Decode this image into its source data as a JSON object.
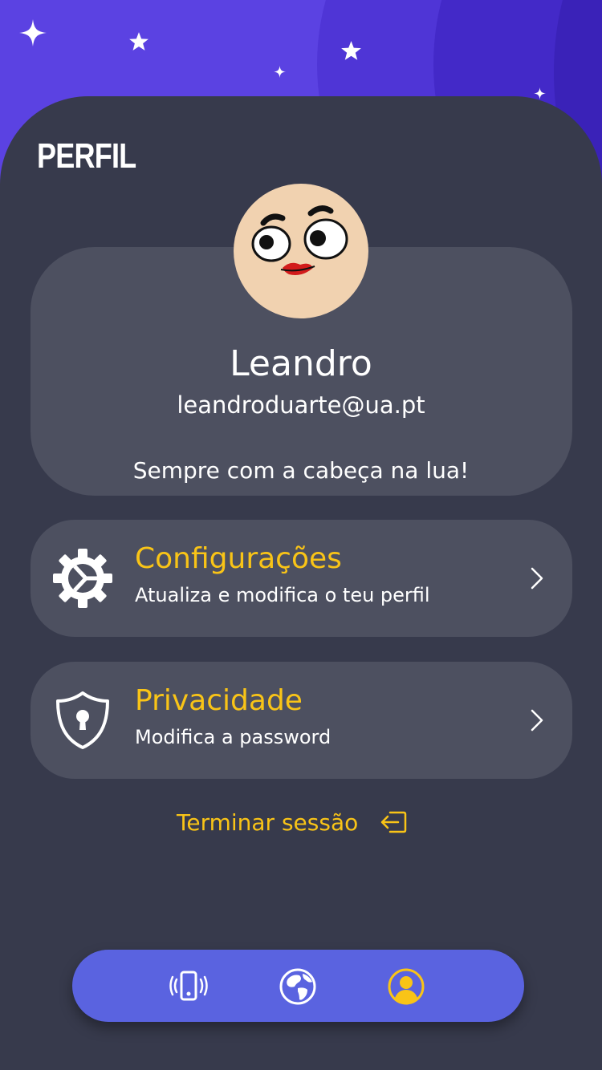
{
  "header": {
    "title": "PERFIL"
  },
  "profile": {
    "name": "Leandro",
    "email": "leandroduarte@ua.pt",
    "bio": "Sempre com a cabeça na lua!"
  },
  "menu": [
    {
      "title": "Configurações",
      "subtitle": "Atualiza e modifica o teu perfil",
      "icon": "gear-icon"
    },
    {
      "title": "Privacidade",
      "subtitle": "Modifica a password",
      "icon": "shield-lock-icon"
    }
  ],
  "logout": {
    "label": "Terminar sessão",
    "icon": "logout-icon"
  },
  "tabbar": {
    "items": [
      {
        "icon": "phone-vibrate-icon",
        "active": false
      },
      {
        "icon": "globe-icon",
        "active": false
      },
      {
        "icon": "profile-icon",
        "active": true
      }
    ]
  },
  "colors": {
    "accent": "#f9c417",
    "panel": "#373a4c",
    "card": "#4d5060",
    "sky": "#5b42e2",
    "tabbar": "#5a63e0"
  }
}
